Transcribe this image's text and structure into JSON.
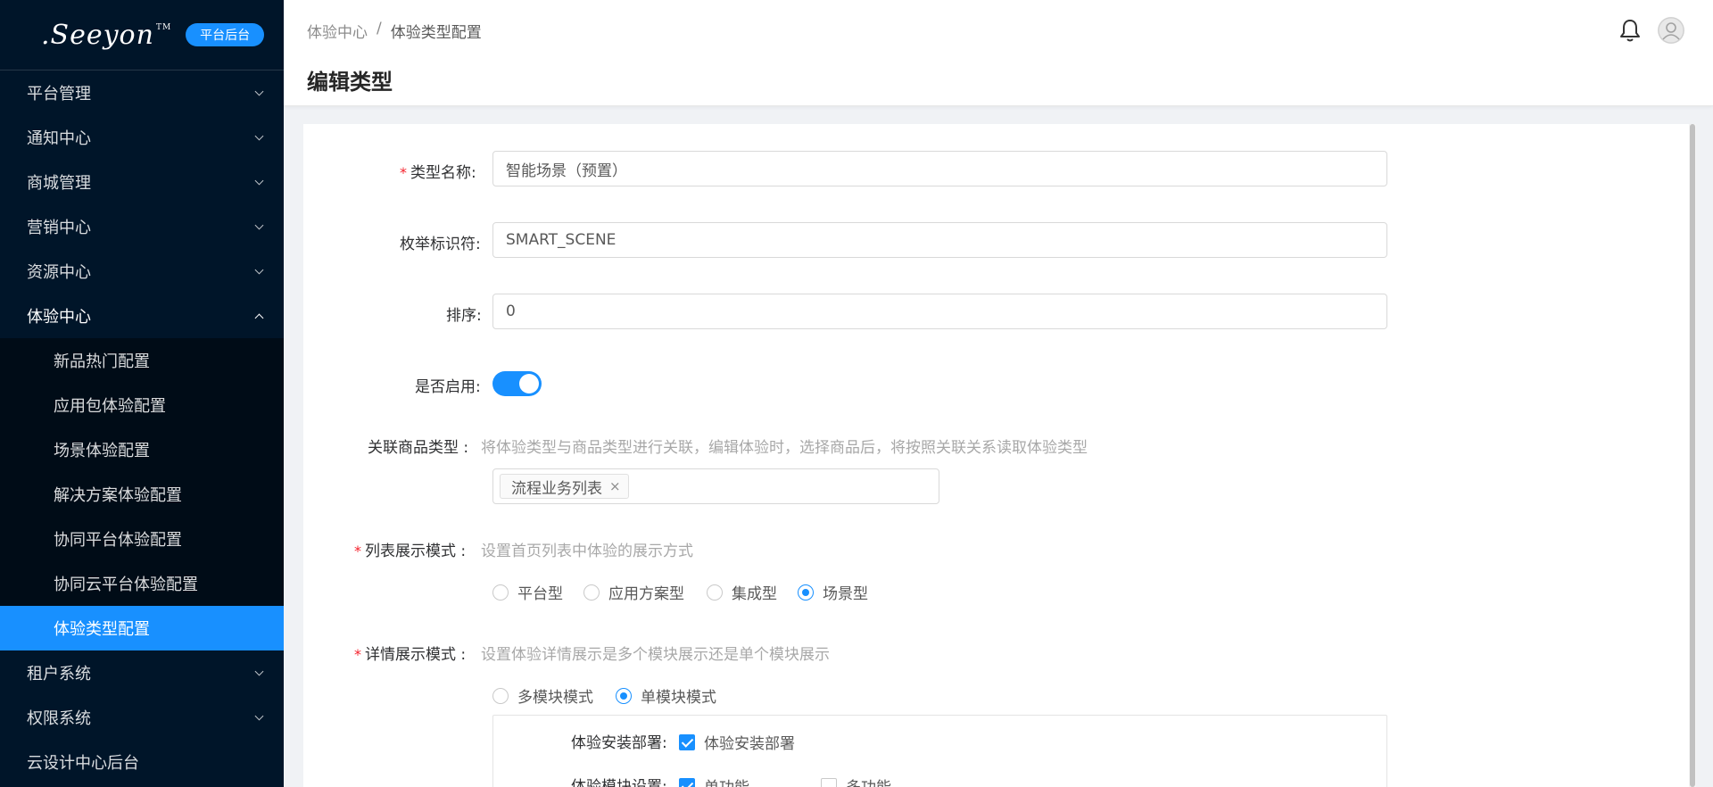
{
  "brand": {
    "logo_text": ".Seeyon",
    "trademark": "TM",
    "badge": "平台后台"
  },
  "sidebar": {
    "items": [
      {
        "label": "平台管理"
      },
      {
        "label": "通知中心"
      },
      {
        "label": "商城管理"
      },
      {
        "label": "营销中心"
      },
      {
        "label": "资源中心"
      },
      {
        "label": "体验中心"
      },
      {
        "label": "租户系统"
      },
      {
        "label": "权限系统"
      },
      {
        "label": "云设计中心后台"
      }
    ],
    "submenu": [
      {
        "label": "新品热门配置"
      },
      {
        "label": "应用包体验配置"
      },
      {
        "label": "场景体验配置"
      },
      {
        "label": "解决方案体验配置"
      },
      {
        "label": "协同平台体验配置"
      },
      {
        "label": "协同云平台体验配置"
      },
      {
        "label": "体验类型配置"
      }
    ]
  },
  "header": {
    "breadcrumb": [
      "体验中心",
      "/",
      "体验类型配置"
    ],
    "title": "编辑类型"
  },
  "form": {
    "type_name": {
      "label": "类型名称:",
      "value": "智能场景（预置）"
    },
    "enum_id": {
      "label": "枚举标识符:",
      "value": "SMART_SCENE"
    },
    "sort": {
      "label": "排序:",
      "value": "0"
    },
    "enabled": {
      "label": "是否启用:",
      "on": true
    },
    "product_type": {
      "label": "关联商品类型 :",
      "hint": "将体验类型与商品类型进行关联，编辑体验时，选择商品后，将按照关联关系读取体验类型",
      "tag": "流程业务列表",
      "tag_close": "×"
    },
    "list_mode": {
      "label": "列表展示模式 :",
      "hint": "设置首页列表中体验的展示方式",
      "options": [
        "平台型",
        "应用方案型",
        "集成型",
        "场景型"
      ],
      "selected": "场景型"
    },
    "detail_mode": {
      "label": "详情展示模式 :",
      "hint": "设置体验详情展示是多个模块展示还是单个模块展示",
      "options": [
        "多模块模式",
        "单模块模式"
      ],
      "selected": "单模块模式"
    },
    "install": {
      "label": "体验安装部署:",
      "check_label": "体验安装部署"
    },
    "module_setting": {
      "label": "体验模块设置:",
      "opt1": "单功能",
      "opt2": "多功能"
    }
  },
  "icons": {
    "bell": "bell-icon",
    "avatar": "user-avatar-icon"
  }
}
